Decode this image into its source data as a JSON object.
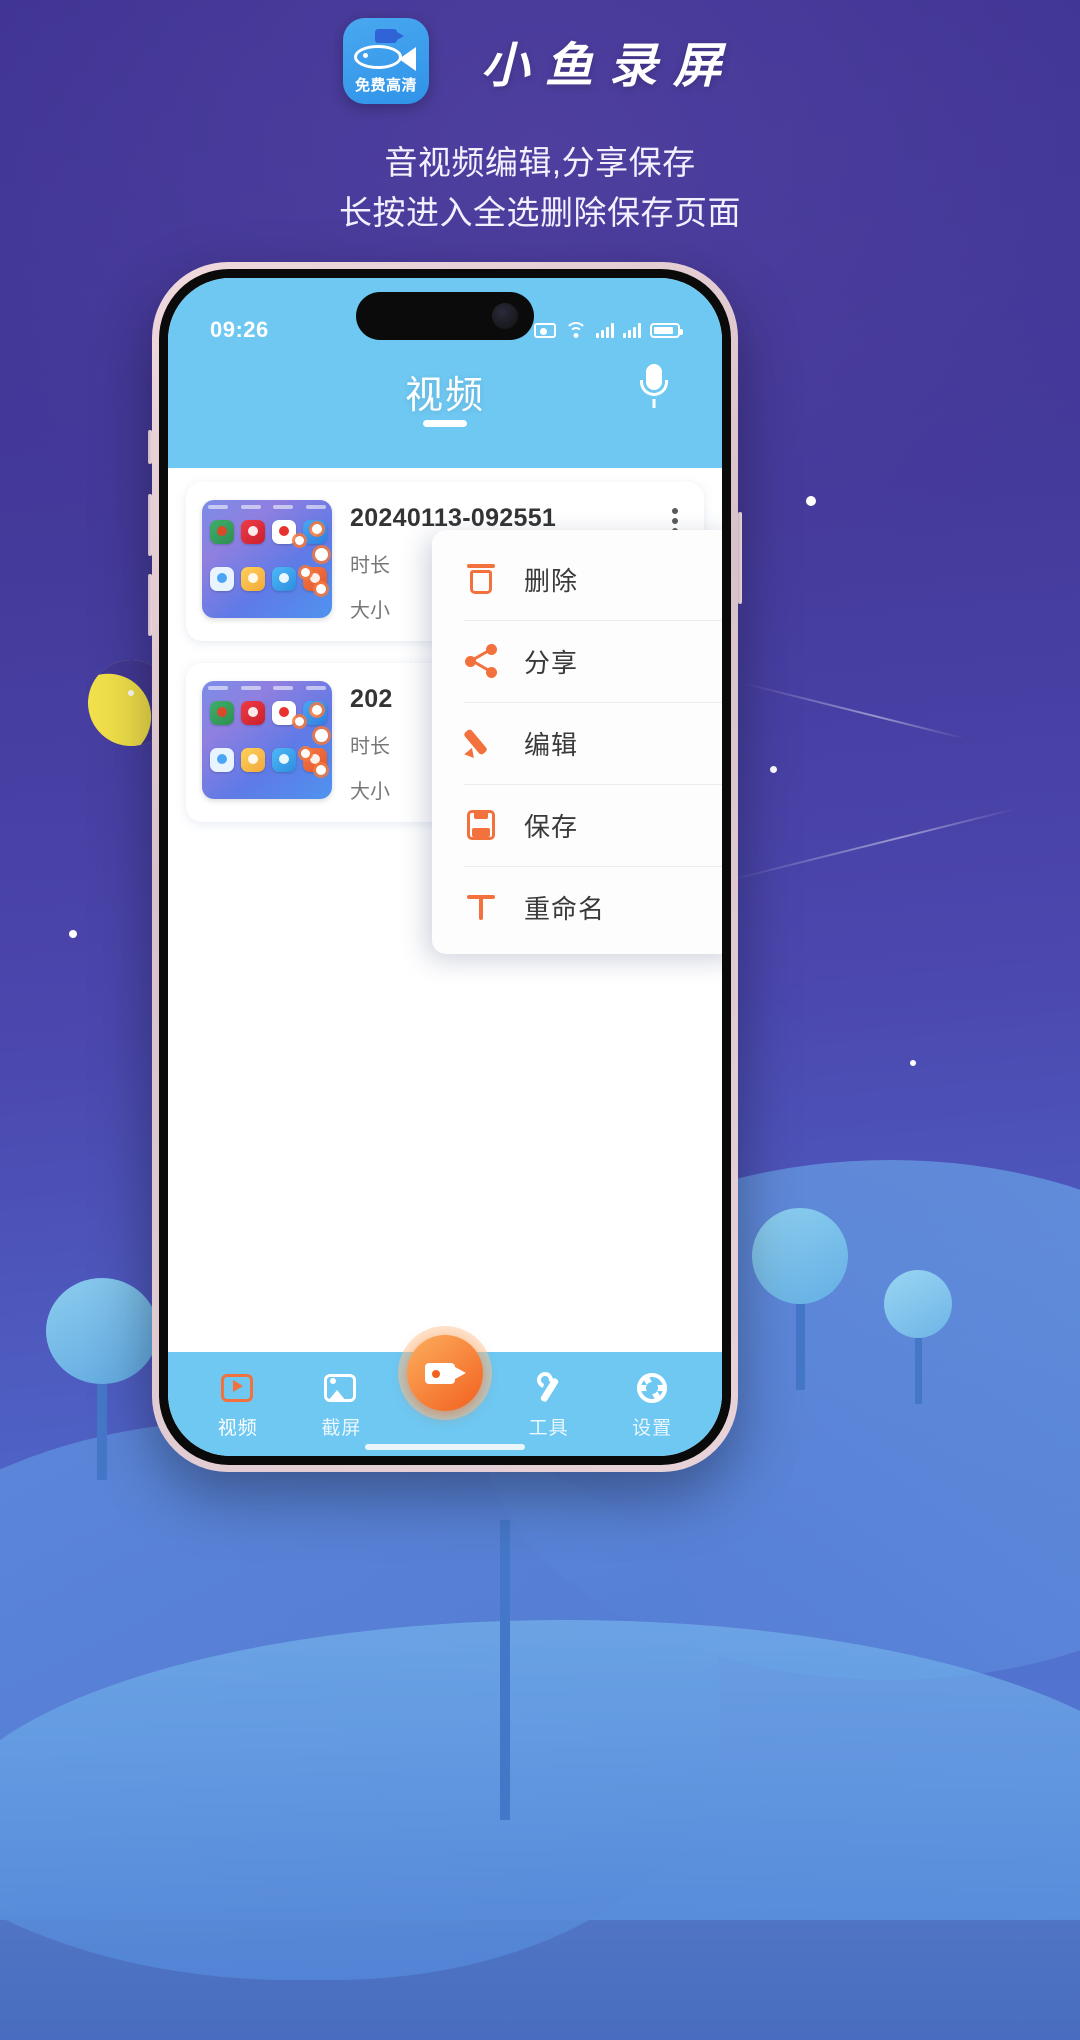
{
  "promo": {
    "app_icon_text": "免费高清",
    "app_icon_name": "fish-video-app-icon",
    "title": "小鱼录屏",
    "subtitle_line1": "音视频编辑,分享保存",
    "subtitle_line2": "长按进入全选删除保存页面"
  },
  "phone": {
    "statusbar": {
      "time": "09:26",
      "icons": [
        "cast-icon",
        "wifi-icon",
        "signal-icon",
        "signal-icon-2",
        "battery-icon"
      ]
    },
    "header": {
      "title": "视频",
      "mic_icon": "microphone-icon"
    },
    "list": [
      {
        "filename": "20240113-092551",
        "duration_label": "时长",
        "size_label": "大小",
        "thumbnail": "home-screen-thumbnail"
      },
      {
        "filename": "202",
        "duration_label": "时长",
        "size_label": "大小",
        "thumbnail": "home-screen-thumbnail"
      }
    ],
    "context_menu": [
      {
        "label": "删除",
        "icon": "trash-icon"
      },
      {
        "label": "分享",
        "icon": "share-icon"
      },
      {
        "label": "编辑",
        "icon": "pencil-icon"
      },
      {
        "label": "保存",
        "icon": "save-icon"
      },
      {
        "label": "重命名",
        "icon": "text-t-icon"
      }
    ],
    "fab": {
      "icon": "add-video-icon"
    },
    "tabbar": [
      {
        "label": "视频",
        "icon": "video-icon",
        "active": true
      },
      {
        "label": "截屏",
        "icon": "image-icon",
        "active": false
      },
      {
        "label": "工具",
        "icon": "wrench-icon",
        "active": false
      },
      {
        "label": "设置",
        "icon": "gear-icon",
        "active": false
      }
    ],
    "record_button": {
      "icon": "record-camera-icon"
    }
  },
  "colors": {
    "brand_blue": "#6ec8f2",
    "accent_orange": "#f2713c",
    "bg_purple": "#443a9b",
    "bg_blue": "#5580d8"
  }
}
